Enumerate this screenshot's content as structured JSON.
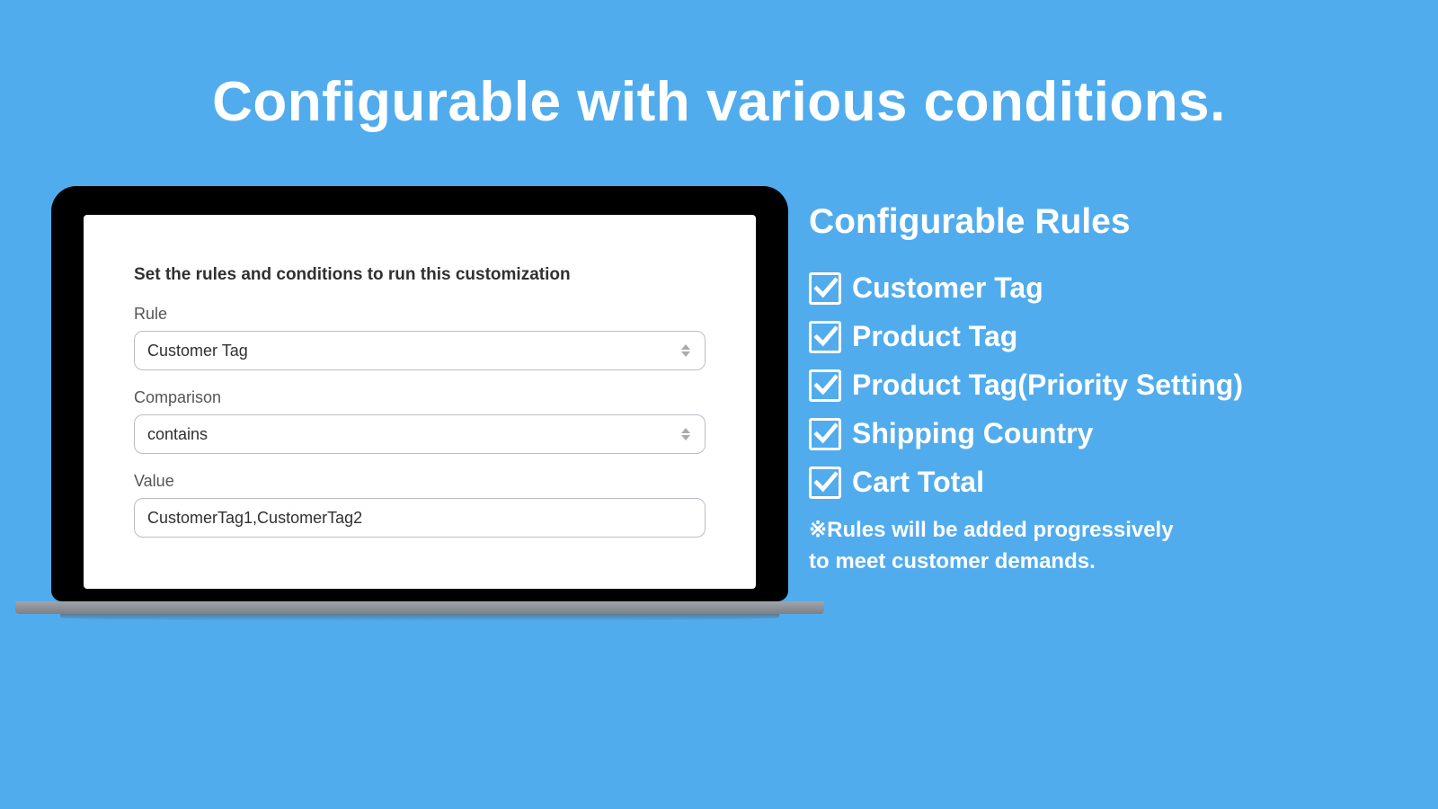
{
  "title": "Configurable with various conditions.",
  "form": {
    "heading": "Set the rules and conditions to run this customization",
    "rule": {
      "label": "Rule",
      "value": "Customer Tag"
    },
    "comparison": {
      "label": "Comparison",
      "value": "contains"
    },
    "value": {
      "label": "Value",
      "value": "CustomerTag1,CustomerTag2"
    }
  },
  "rules_panel": {
    "title": "Configurable Rules",
    "items": [
      {
        "label": "Customer Tag"
      },
      {
        "label": "Product Tag"
      },
      {
        "label": "Product Tag(Priority Setting)"
      },
      {
        "label": "Shipping Country"
      },
      {
        "label": "Cart Total"
      }
    ],
    "note": "※Rules will be added progressively\nto meet customer demands."
  }
}
